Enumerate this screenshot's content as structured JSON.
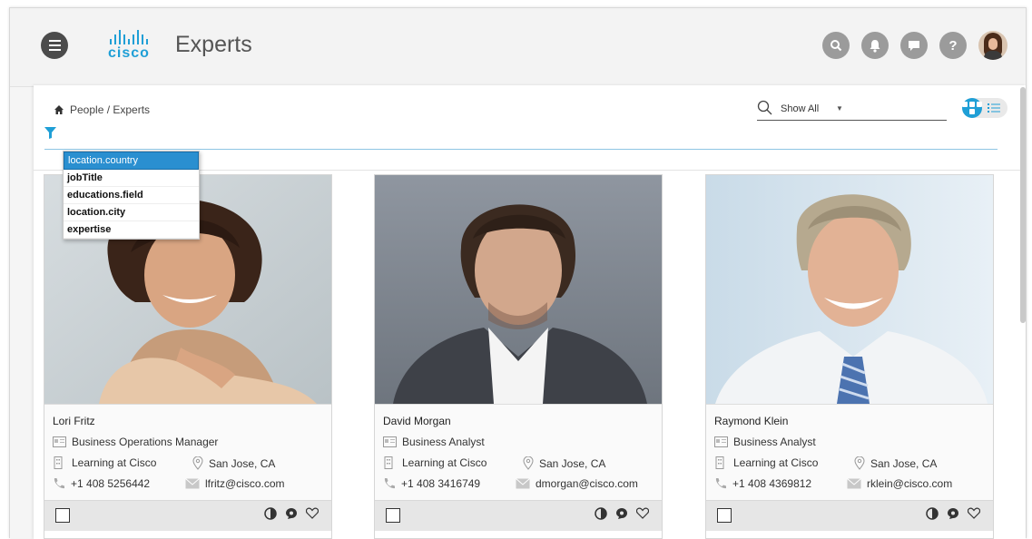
{
  "app": {
    "brand": "cisco",
    "title": "Experts",
    "accent_color": "#1f9fd6"
  },
  "header_icons": [
    "menu-icon",
    "search-icon",
    "bell-icon",
    "chat-icon",
    "help-icon",
    "user-avatar"
  ],
  "breadcrumb": "People / Experts",
  "search": {
    "filter_label": "Show All"
  },
  "filter_dropdown": {
    "items": [
      "location.country",
      "jobTitle",
      "educations.field",
      "location.city",
      "expertise"
    ],
    "selected_index": 0
  },
  "experts": [
    {
      "name": "Lori Fritz",
      "title": "Business Operations Manager",
      "department": "Learning at Cisco",
      "location": "San Jose, CA",
      "phone": "+1 408 5256442",
      "email": "lfritz@cisco.com"
    },
    {
      "name": "David Morgan",
      "title": "Business Analyst",
      "department": "Learning at Cisco",
      "location": "San Jose, CA",
      "phone": "+1 408 3416749",
      "email": "dmorgan@cisco.com"
    },
    {
      "name": "Raymond Klein",
      "title": "Business Analyst",
      "department": "Learning at Cisco",
      "location": "San Jose, CA",
      "phone": "+1 408 4369812",
      "email": "rklein@cisco.com"
    }
  ]
}
